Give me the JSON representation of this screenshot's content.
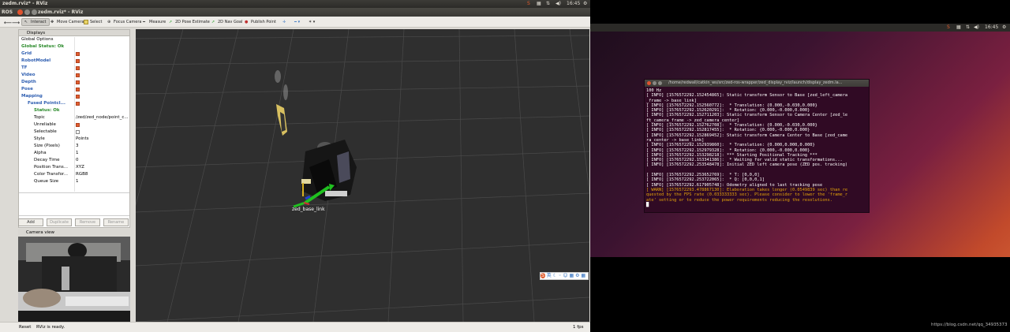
{
  "os_bar": {
    "title": "zedm.rviz* - RViz",
    "time": "16:45",
    "right_time": "16:45"
  },
  "window": {
    "app": "ROS",
    "title": "zedm.rviz* - RViz"
  },
  "toolbar": [
    {
      "label": "Interact",
      "icon": "cursor-icon",
      "active": true
    },
    {
      "label": "Move Camera",
      "icon": "move-camera-icon",
      "active": false
    },
    {
      "label": "Select",
      "icon": "select-icon",
      "active": false
    },
    {
      "label": "Focus Camera",
      "icon": "focus-camera-icon",
      "active": false
    },
    {
      "label": "Measure",
      "icon": "measure-icon",
      "active": false
    },
    {
      "label": "2D Pose Estimate",
      "icon": "pose-estimate-icon",
      "active": false
    },
    {
      "label": "2D Nav Goal",
      "icon": "nav-goal-icon",
      "active": false
    },
    {
      "label": "Publish Point",
      "icon": "publish-point-icon",
      "active": false
    }
  ],
  "displays": {
    "title": "Displays",
    "rows": [
      {
        "label": "Global Options",
        "indent": 0,
        "style": "normal",
        "check": null,
        "value": ""
      },
      {
        "label": "Global Status: Ok",
        "indent": 0,
        "style": "status",
        "check": null,
        "value": ""
      },
      {
        "label": "Grid",
        "indent": 0,
        "style": "blue",
        "check": true,
        "value": ""
      },
      {
        "label": "RobotModel",
        "indent": 0,
        "style": "blue",
        "check": true,
        "value": ""
      },
      {
        "label": "TF",
        "indent": 0,
        "style": "blue",
        "check": true,
        "value": ""
      },
      {
        "label": "Video",
        "indent": 0,
        "style": "blue",
        "check": true,
        "value": ""
      },
      {
        "label": "Depth",
        "indent": 0,
        "style": "blue",
        "check": true,
        "value": ""
      },
      {
        "label": "Pose",
        "indent": 0,
        "style": "blue",
        "check": true,
        "value": ""
      },
      {
        "label": "Mapping",
        "indent": 0,
        "style": "blue",
        "check": true,
        "value": ""
      },
      {
        "label": "Fused Pointcl...",
        "indent": 1,
        "style": "blue",
        "check": true,
        "value": ""
      },
      {
        "label": "Status: Ok",
        "indent": 2,
        "style": "status",
        "check": null,
        "value": ""
      },
      {
        "label": "Topic",
        "indent": 2,
        "style": "normal",
        "check": null,
        "value": "/zed/zed_node/point_c..."
      },
      {
        "label": "Unreliable",
        "indent": 2,
        "style": "normal",
        "check": true,
        "value": ""
      },
      {
        "label": "Selectable",
        "indent": 2,
        "style": "normal",
        "check": false,
        "value": ""
      },
      {
        "label": "Style",
        "indent": 2,
        "style": "normal",
        "check": null,
        "value": "Points"
      },
      {
        "label": "Size (Pixels)",
        "indent": 2,
        "style": "normal",
        "check": null,
        "value": "3"
      },
      {
        "label": "Alpha",
        "indent": 2,
        "style": "normal",
        "check": null,
        "value": "1"
      },
      {
        "label": "Decay Time",
        "indent": 2,
        "style": "normal",
        "check": null,
        "value": "0"
      },
      {
        "label": "Position Trans...",
        "indent": 2,
        "style": "normal",
        "check": null,
        "value": "XYZ"
      },
      {
        "label": "Color Transfor...",
        "indent": 2,
        "style": "normal",
        "check": null,
        "value": "RGB8"
      },
      {
        "label": "Queue Size",
        "indent": 2,
        "style": "normal",
        "check": null,
        "value": "1"
      }
    ],
    "buttons": [
      {
        "label": "Add",
        "enabled": true
      },
      {
        "label": "Duplicate",
        "enabled": false
      },
      {
        "label": "Remove",
        "enabled": false
      },
      {
        "label": "Rename",
        "enabled": false
      }
    ]
  },
  "camera_view": {
    "title": "Camera view"
  },
  "viewport": {
    "frame_label": "zed_base_link"
  },
  "status_bar": {
    "reset": "Reset",
    "message": "RViz is ready.",
    "fps": "1 fps"
  },
  "terminal": {
    "title": "/home/redwall/catkin_ws/src/zed-ros-wrapper/zed_display_rviz/launch/display_zedm.la...",
    "lines": [
      {
        "text": "100 Hz",
        "warn": false
      },
      {
        "text": "[ INFO] [1576572292.152454865]: Static transform Sensor to Base [zed_left_camera",
        "warn": false
      },
      {
        "text": "_frame -> base_link]",
        "warn": false
      },
      {
        "text": "[ INFO] [1576572292.152560772]:  * Translation: {0.000,-0.030,0.000}",
        "warn": false
      },
      {
        "text": "[ INFO] [1576572292.152620291]:  * Rotation: {0.000,-0.000,0.000}",
        "warn": false
      },
      {
        "text": "[ INFO] [1576572292.152711203]: Static transform Sensor to Camera Center [zed_le",
        "warn": false
      },
      {
        "text": "ft_camera_frame -> zed_camera_center]",
        "warn": false
      },
      {
        "text": "[ INFO] [1576572292.152762708]:  * Translation: {0.000,-0.030,0.000}",
        "warn": false
      },
      {
        "text": "[ INFO] [1576572292.152817455]:  * Rotation: {0.000,-0.000,0.000}",
        "warn": false
      },
      {
        "text": "[ INFO] [1576572292.152869452]: Static transform Camera Center to Base [zed_came",
        "warn": false
      },
      {
        "text": "ra_center -> base_link]",
        "warn": false
      },
      {
        "text": "[ INFO] [1576572292.152939860]:  * Translation: {0.000,0.000,0.000}",
        "warn": false
      },
      {
        "text": "[ INFO] [1576572292.152979328]:  * Rotation: {0.000,-0.000,0.000}",
        "warn": false
      },
      {
        "text": "[ INFO] [1576572292.153298218]: *** Starting Positional Tracking ***",
        "warn": false
      },
      {
        "text": "[ INFO] [1576572292.153341386]:  * Waiting for valid static transformations...",
        "warn": false
      },
      {
        "text": "[ INFO] [1576572292.253548478]: Initial ZED left camera pose (ZED pos. tracking)",
        "warn": false
      },
      {
        "text": "",
        "warn": false
      },
      {
        "text": "[ INFO] [1576572292.253652769]:  * T: [0,0,0]",
        "warn": false
      },
      {
        "text": "[ INFO] [1576572292.253722065]:  * Q: [0,0,0,1]",
        "warn": false
      },
      {
        "text": "[ INFO] [1576572292.617905748]: Odometry aligned to last tracking pose",
        "warn": false
      },
      {
        "text": "[ WARN] [1576572293.478867130]: Elaboration takes longer (0.0549839 sec) than re",
        "warn": true
      },
      {
        "text": "quested by the FPS rate (0.033333333 sec). Please consider to lower the 'frame_r",
        "warn": true
      },
      {
        "text": "ate' setting or to reduce the power requirements reducing the resolutions.",
        "warn": true
      },
      {
        "text": "█",
        "warn": false
      }
    ]
  },
  "watermark": "https://blog.csdn.net/qq_34935373"
}
